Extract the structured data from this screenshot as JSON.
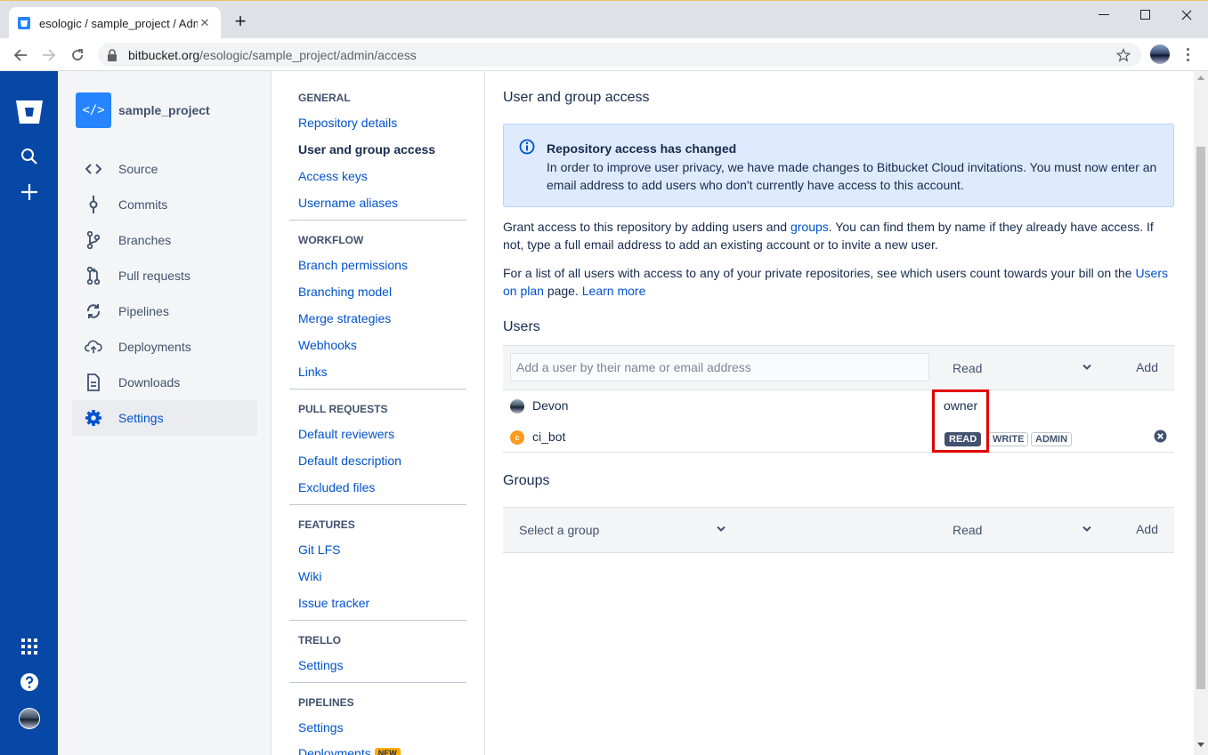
{
  "browser": {
    "tab_title": "esologic / sample_project / Admin",
    "tab_close": "✕",
    "new_tab": "+",
    "url_host": "bitbucket.org",
    "url_path": "/esologic/sample_project/admin/access"
  },
  "project": {
    "icon_text": "</>",
    "name": "sample_project"
  },
  "project_nav": [
    {
      "label": "Source",
      "icon": "code-icon"
    },
    {
      "label": "Commits",
      "icon": "commit-icon"
    },
    {
      "label": "Branches",
      "icon": "branch-icon"
    },
    {
      "label": "Pull requests",
      "icon": "pull-request-icon"
    },
    {
      "label": "Pipelines",
      "icon": "pipelines-icon"
    },
    {
      "label": "Deployments",
      "icon": "deploy-icon"
    },
    {
      "label": "Downloads",
      "icon": "document-icon"
    },
    {
      "label": "Settings",
      "icon": "gear-icon",
      "active": true
    }
  ],
  "settings_nav": {
    "general": {
      "heading": "GENERAL",
      "links": [
        "Repository details",
        "User and group access",
        "Access keys",
        "Username aliases"
      ]
    },
    "workflow": {
      "heading": "WORKFLOW",
      "links": [
        "Branch permissions",
        "Branching model",
        "Merge strategies",
        "Webhooks",
        "Links"
      ]
    },
    "pull_requests": {
      "heading": "PULL REQUESTS",
      "links": [
        "Default reviewers",
        "Default description",
        "Excluded files"
      ]
    },
    "features": {
      "heading": "FEATURES",
      "links": [
        "Git LFS",
        "Wiki",
        "Issue tracker"
      ]
    },
    "trello": {
      "heading": "TRELLO",
      "links": [
        "Settings"
      ]
    },
    "pipelines": {
      "heading": "PIPELINES",
      "links": [
        "Settings",
        "Deployments"
      ],
      "new_badge": "NEW"
    }
  },
  "main": {
    "title": "User and group access",
    "banner": {
      "title": "Repository access has changed",
      "text": "In order to improve user privacy, we have made changes to Bitbucket Cloud invitations. You must now enter an email address to add users who don't currently have access to this account."
    },
    "para1": {
      "a": "Grant access to this repository by adding users and ",
      "link": "groups",
      "b": ". You can find them by name if they already have access. If not, type a full email address to add an existing account or to invite a new user."
    },
    "para2": {
      "a": "For a list of all users with access to any of your private repositories, see which users count towards your bill on the ",
      "link": "Users on plan",
      "b": " page. ",
      "link2": "Learn more"
    },
    "users": {
      "heading": "Users",
      "input_placeholder": "Add a user by their name or email address",
      "permission": "Read",
      "add_label": "Add",
      "rows": [
        {
          "name": "Devon",
          "role": "owner"
        },
        {
          "name": "ci_bot",
          "avatar_letter": "c",
          "permissions": [
            "READ",
            "WRITE",
            "ADMIN"
          ],
          "selected": "READ"
        }
      ]
    },
    "groups": {
      "heading": "Groups",
      "select_placeholder": "Select a group",
      "permission": "Read",
      "add_label": "Add"
    }
  },
  "colors": {
    "global_nav": "#0747A6",
    "link": "#0052CC",
    "banner_bg": "#DEEBFF",
    "highlight_box": "#E00000",
    "ci_bot_avatar": "#FF991F"
  }
}
